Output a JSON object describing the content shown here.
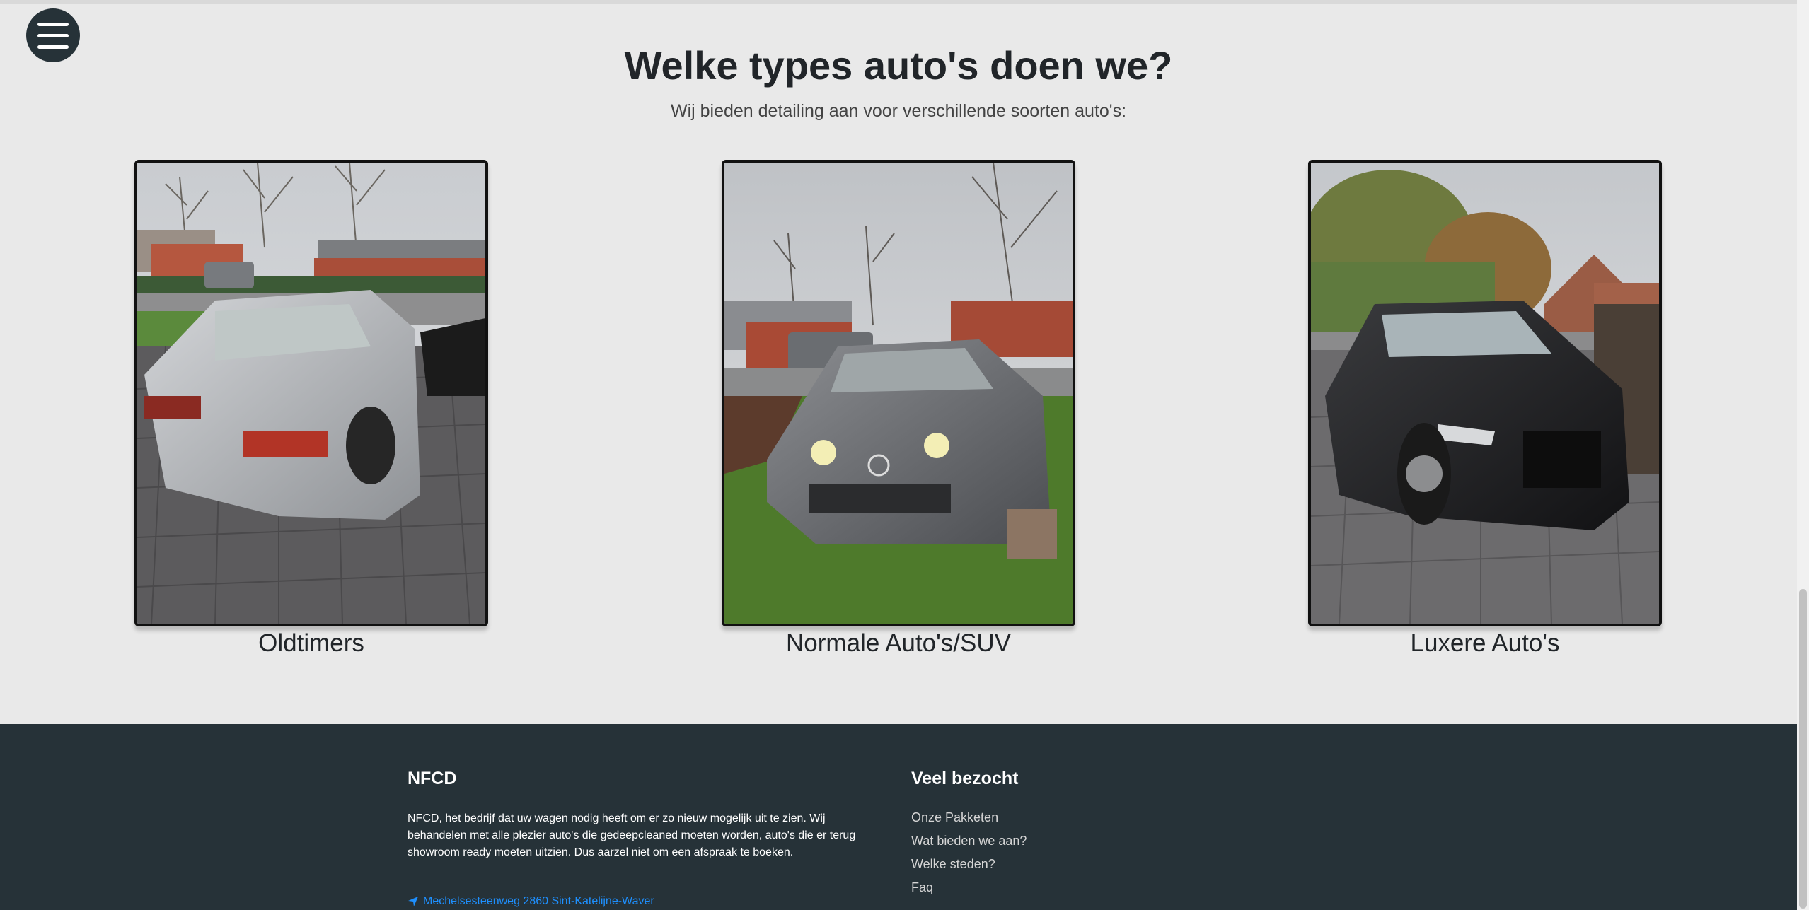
{
  "nav": {
    "menu_icon": "hamburger-icon"
  },
  "section": {
    "title": "Welke types auto's doen we?",
    "subtitle": "Wij bieden detailing aan voor verschillende soorten auto's:"
  },
  "cards": [
    {
      "label": "Oldtimers"
    },
    {
      "label": "Normale Auto's/SUV"
    },
    {
      "label": "Luxere Auto's"
    }
  ],
  "footer": {
    "brand_title": "NFCD",
    "brand_text": "NFCD, het bedrijf dat uw wagen nodig heeft om er zo nieuw mogelijk uit te zien. Wij behandelen met alle plezier auto's die gedeepcleaned moeten worden, auto's die er terug showroom ready moeten uitzien. Dus aarzel niet om een afspraak te boeken.",
    "address": "Mechelsesteenweg 2860 Sint-Katelijne-Waver",
    "links_title": "Veel bezocht",
    "links": [
      "Onze Pakketen",
      "Wat bieden we aan?",
      "Welke steden?",
      "Faq"
    ]
  },
  "colors": {
    "footer_bg": "#263238",
    "link_accent": "#1e90ff",
    "page_bg": "#e9e9e9"
  }
}
